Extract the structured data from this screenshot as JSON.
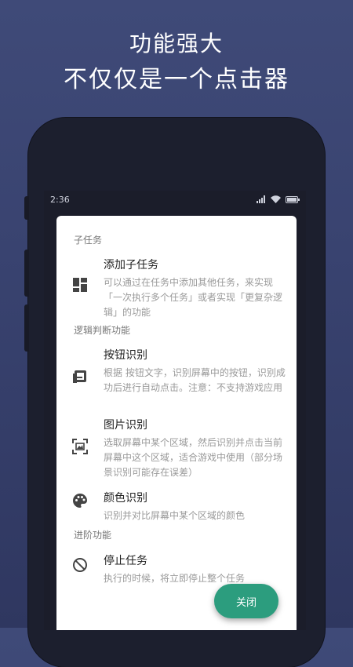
{
  "headline": {
    "line1": "功能强大",
    "line2": "不仅仅是一个点击器"
  },
  "status_bar": {
    "time": "2:36"
  },
  "dialog": {
    "sections": [
      {
        "label": "子任务",
        "items": [
          {
            "title": "添加子任务",
            "icon": "dashboard-icon",
            "desc": "可以通过在任务中添加其他任务，来实现「一次执行多个任务」或者实现「更复杂逻辑」的功能"
          }
        ]
      },
      {
        "label": "逻辑判断功能",
        "items": [
          {
            "title": "按钮识别",
            "icon": "button-icon",
            "desc": "根据 按钮文字，识别屏幕中的按钮，识别成功后进行自动点击。注意：不支持游戏应用"
          },
          {
            "title": "图片识别",
            "icon": "image-scan-icon",
            "desc": "选取屏幕中某个区域，然后识别并点击当前屏幕中这个区域，适合游戏中使用（部分场景识别可能存在误差）"
          },
          {
            "title": "颜色识别",
            "icon": "palette-icon",
            "desc": "识别并对比屏幕中某个区域的颜色"
          }
        ]
      },
      {
        "label": "进阶功能",
        "items": [
          {
            "title": "停止任务",
            "icon": "stop-icon",
            "desc": "执行的时候，将立即停止整个任务"
          }
        ]
      }
    ],
    "close_label": "关闭"
  },
  "colors": {
    "accent": "#2c9d7e",
    "background": "#3b4573",
    "dialog_bg": "#ffffff"
  }
}
